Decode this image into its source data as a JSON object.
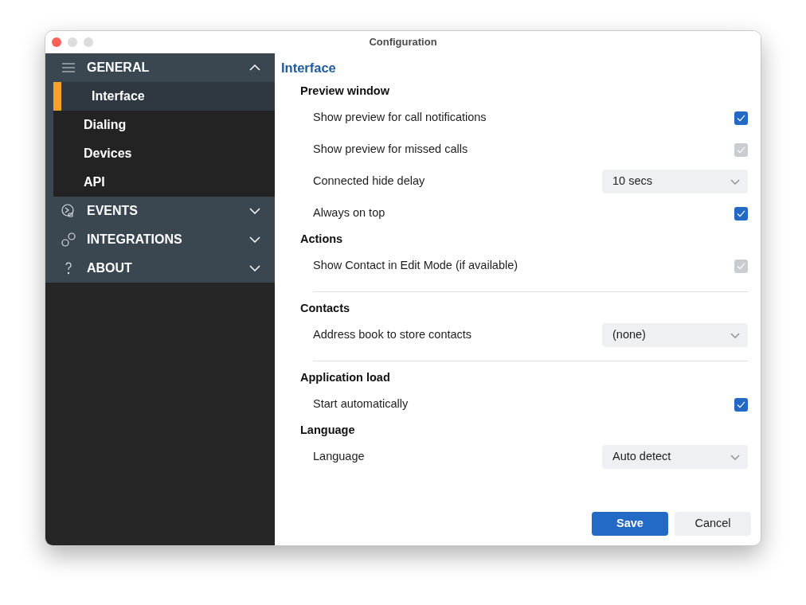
{
  "window": {
    "title": "Configuration"
  },
  "sidebar": {
    "groups": [
      {
        "label": "GENERAL",
        "expanded": true,
        "children": [
          {
            "label": "Interface",
            "selected": true
          },
          {
            "label": "Dialing",
            "selected": false
          },
          {
            "label": "Devices",
            "selected": false
          },
          {
            "label": "API",
            "selected": false
          }
        ]
      },
      {
        "label": "EVENTS",
        "expanded": false
      },
      {
        "label": "INTEGRATIONS",
        "expanded": false
      },
      {
        "label": "ABOUT",
        "expanded": false
      }
    ]
  },
  "page": {
    "title": "Interface",
    "sections": [
      {
        "kind": "section",
        "title": "Preview window",
        "rows": [
          {
            "kind": "checkbox",
            "label": "Show preview for call notifications",
            "checked": true,
            "disabled": false
          },
          {
            "kind": "checkbox",
            "label": "Show preview for missed calls",
            "checked": true,
            "disabled": true
          },
          {
            "kind": "select",
            "label": "Connected hide delay",
            "value": "10 secs"
          },
          {
            "kind": "checkbox",
            "label": "Always on top",
            "checked": true,
            "disabled": false
          }
        ]
      },
      {
        "kind": "section",
        "title": "Actions",
        "rows": [
          {
            "kind": "checkbox",
            "label": "Show Contact in Edit Mode (if available)",
            "checked": true,
            "disabled": true
          }
        ]
      },
      {
        "kind": "divider"
      },
      {
        "kind": "section",
        "title": "Contacts",
        "rows": [
          {
            "kind": "select",
            "label": "Address book to store contacts",
            "value": "(none)"
          }
        ]
      },
      {
        "kind": "divider"
      },
      {
        "kind": "section",
        "title": "Application load",
        "rows": [
          {
            "kind": "checkbox",
            "label": "Start automatically",
            "checked": true,
            "disabled": false
          }
        ]
      },
      {
        "kind": "section",
        "title": "Language",
        "rows": [
          {
            "kind": "select",
            "label": "Language",
            "value": "Auto detect"
          }
        ]
      }
    ]
  },
  "buttons": [
    {
      "label": "Save",
      "kind": "primary"
    },
    {
      "label": "Cancel",
      "kind": "secondary"
    }
  ]
}
